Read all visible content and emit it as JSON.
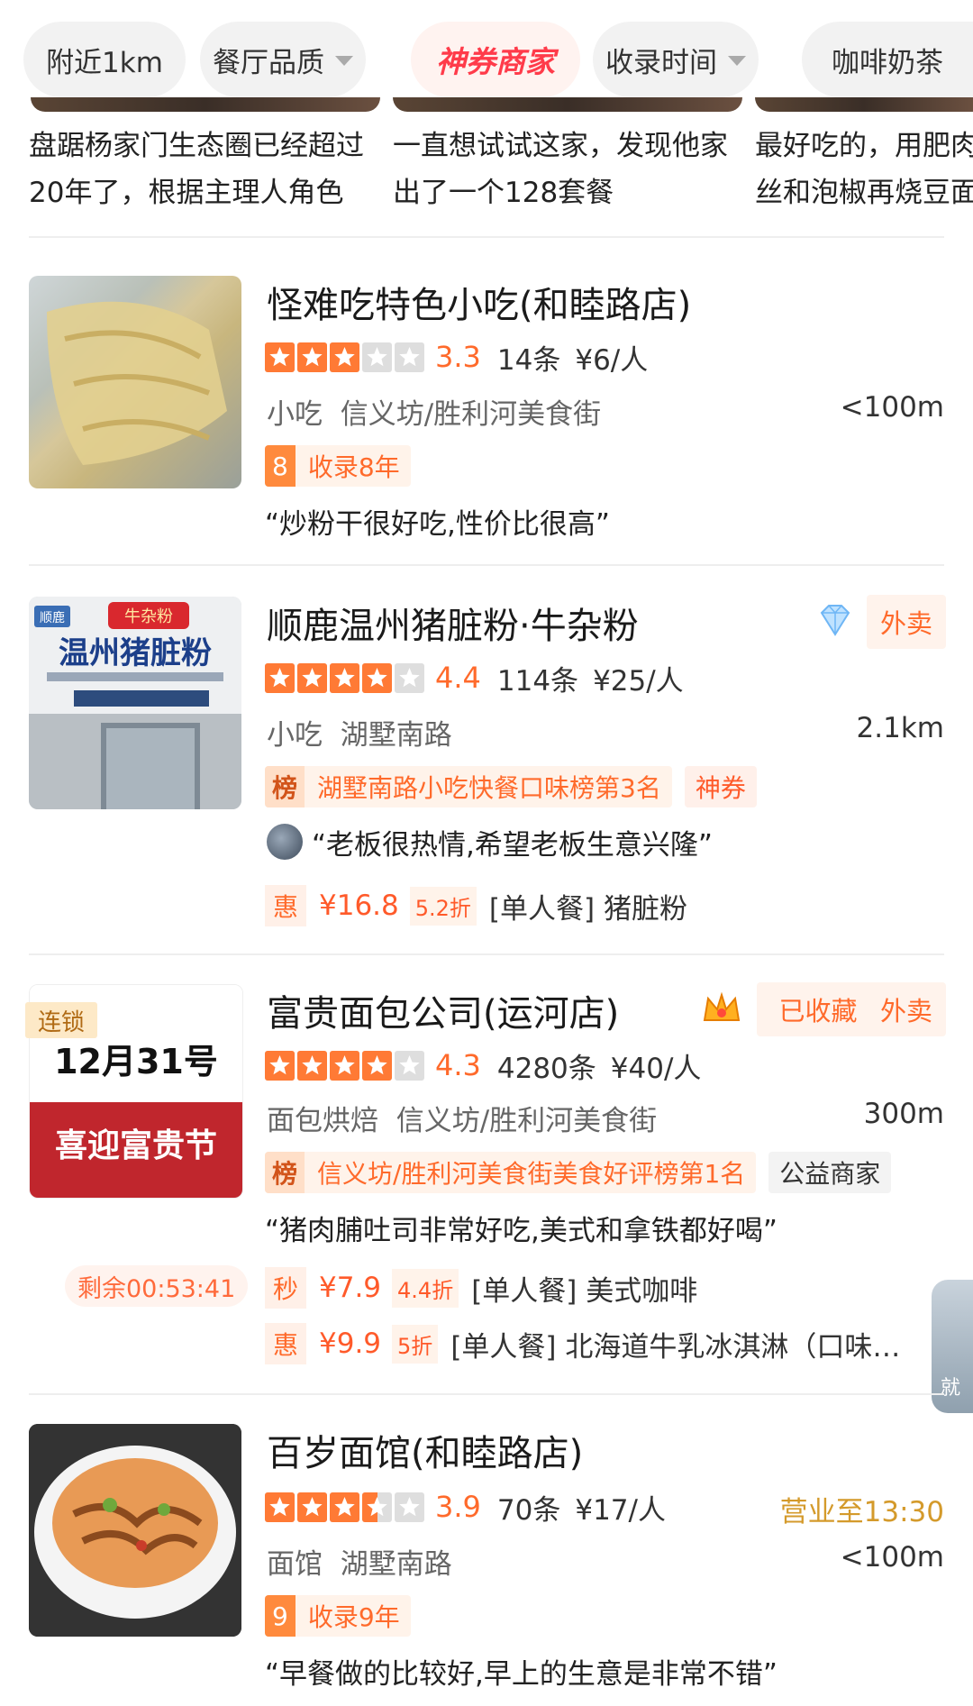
{
  "filters": [
    {
      "label": "附近1km",
      "dropdown": false
    },
    {
      "label": "餐厅品质",
      "dropdown": true
    },
    {
      "label": "神券商家",
      "dropdown": false
    },
    {
      "label": "收录时间",
      "dropdown": true
    },
    {
      "label": "咖啡奶茶",
      "dropdown": false
    }
  ],
  "top_cards": [
    {
      "text_line1": "盘踞杨家门生态圈已经超过",
      "text_line2": "20年了，根据主理人角色"
    },
    {
      "text_line1": "一直想试试这家，发现他家",
      "text_line2": "出了一个128套餐"
    },
    {
      "text_line1": "最好吃的，用肥肉",
      "text_line2": "丝和泡椒再烧豆面"
    }
  ],
  "shops": [
    {
      "name": "怪难吃特色小吃(和睦路店)",
      "stars": 3,
      "score": "3.3",
      "reviews": "14条",
      "price": "¥6/人",
      "category": "小吃",
      "area": "信义坊/胜利河美食街",
      "distance": "<100m",
      "tag_badge": "8",
      "tag_text": "收录8年",
      "quote": "“炒粉干很好吃,性价比很高”"
    },
    {
      "name": "顺鹿温州猪脏粉·牛杂粉",
      "stars": 4,
      "score": "4.4",
      "reviews": "114条",
      "price": "¥25/人",
      "category": "小吃",
      "area": "湖墅南路",
      "distance": "2.1km",
      "waimai": "外卖",
      "rank_badge": "榜",
      "rank_text": "湖墅南路小吃快餐口味榜第3名",
      "extra_tag": "神券",
      "quote": "“老板很热情,希望老板生意兴隆”",
      "deal": {
        "badge": "惠",
        "price": "¥16.8",
        "discount": "5.2折",
        "name": "[单人餐] 猪脏粉"
      },
      "thumb_sign_top": "牛杂粉",
      "thumb_sign_main": "温州猪脏粉",
      "thumb_sign_tag": "顺鹿"
    },
    {
      "name": "富贵面包公司(运河店)",
      "stars": 4,
      "score": "4.3",
      "reviews": "4280条",
      "price": "¥40/人",
      "category": "面包烘焙",
      "area": "信义坊/胜利河美食街",
      "distance": "300m",
      "collected": "已收藏",
      "waimai": "外卖",
      "rank_badge": "榜",
      "rank_text": "信义坊/胜利河美食街美食好评榜第1名",
      "extra_tag": "公益商家",
      "quote": "“猪肉脯吐司非常好吃,美式和拿铁都好喝”",
      "chain_label": "连锁",
      "thumb_date": "12月31号",
      "thumb_slogan": "喜迎富贵节",
      "countdown": "剩余00:53:41",
      "deals": [
        {
          "badge": "秒",
          "price": "¥7.9",
          "discount": "4.4折",
          "name": "[单人餐] 美式咖啡"
        },
        {
          "badge": "惠",
          "price": "¥9.9",
          "discount": "5折",
          "name": "[单人餐] 北海道牛乳冰淇淋（口味…"
        }
      ]
    },
    {
      "name": "百岁面馆(和睦路店)",
      "stars": 3.5,
      "score": "3.9",
      "reviews": "70条",
      "price": "¥17/人",
      "category": "面馆",
      "area": "湖墅南路",
      "distance": "<100m",
      "open_until": "营业至13:30",
      "tag_badge": "9",
      "tag_text": "收录9年",
      "quote": "“早餐做的比较好,早上的生意是非常不错”"
    }
  ],
  "float_button": {
    "label": "就"
  },
  "colors": {
    "accent": "#ff6a2b",
    "star": "#ff7a35",
    "gold": "#d49a2b"
  },
  "icons": [
    "chevron-down-icon",
    "star-icon",
    "diamond-icon",
    "crown-icon"
  ]
}
